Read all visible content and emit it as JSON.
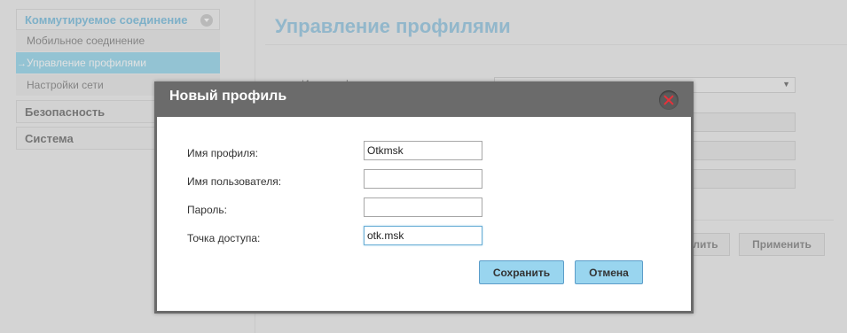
{
  "sidebar": {
    "section_title": "Коммутируемое соединение",
    "items": [
      {
        "label": "Мобильное соединение",
        "active": false
      },
      {
        "label": "Управление профилями",
        "active": true
      },
      {
        "label": "Настройки сети",
        "active": false
      }
    ],
    "active_arrow": "→",
    "sections": [
      {
        "label": "Безопасность"
      },
      {
        "label": "Система"
      }
    ]
  },
  "main": {
    "title": "Управление профилями",
    "bg_label": "Имя профиля",
    "select_arrow": "▼",
    "buttons": {
      "delete_partial": "лить",
      "apply": "Применить"
    }
  },
  "dialog": {
    "title": "Новый профиль",
    "fields": [
      {
        "label": "Имя профиля:",
        "value": "Otkmsk"
      },
      {
        "label": "Имя пользователя:",
        "value": ""
      },
      {
        "label": "Пароль:",
        "value": ""
      },
      {
        "label": "Точка доступа:",
        "value": "otk.msk"
      }
    ],
    "save_label": "Сохранить",
    "cancel_label": "Отмена"
  }
}
